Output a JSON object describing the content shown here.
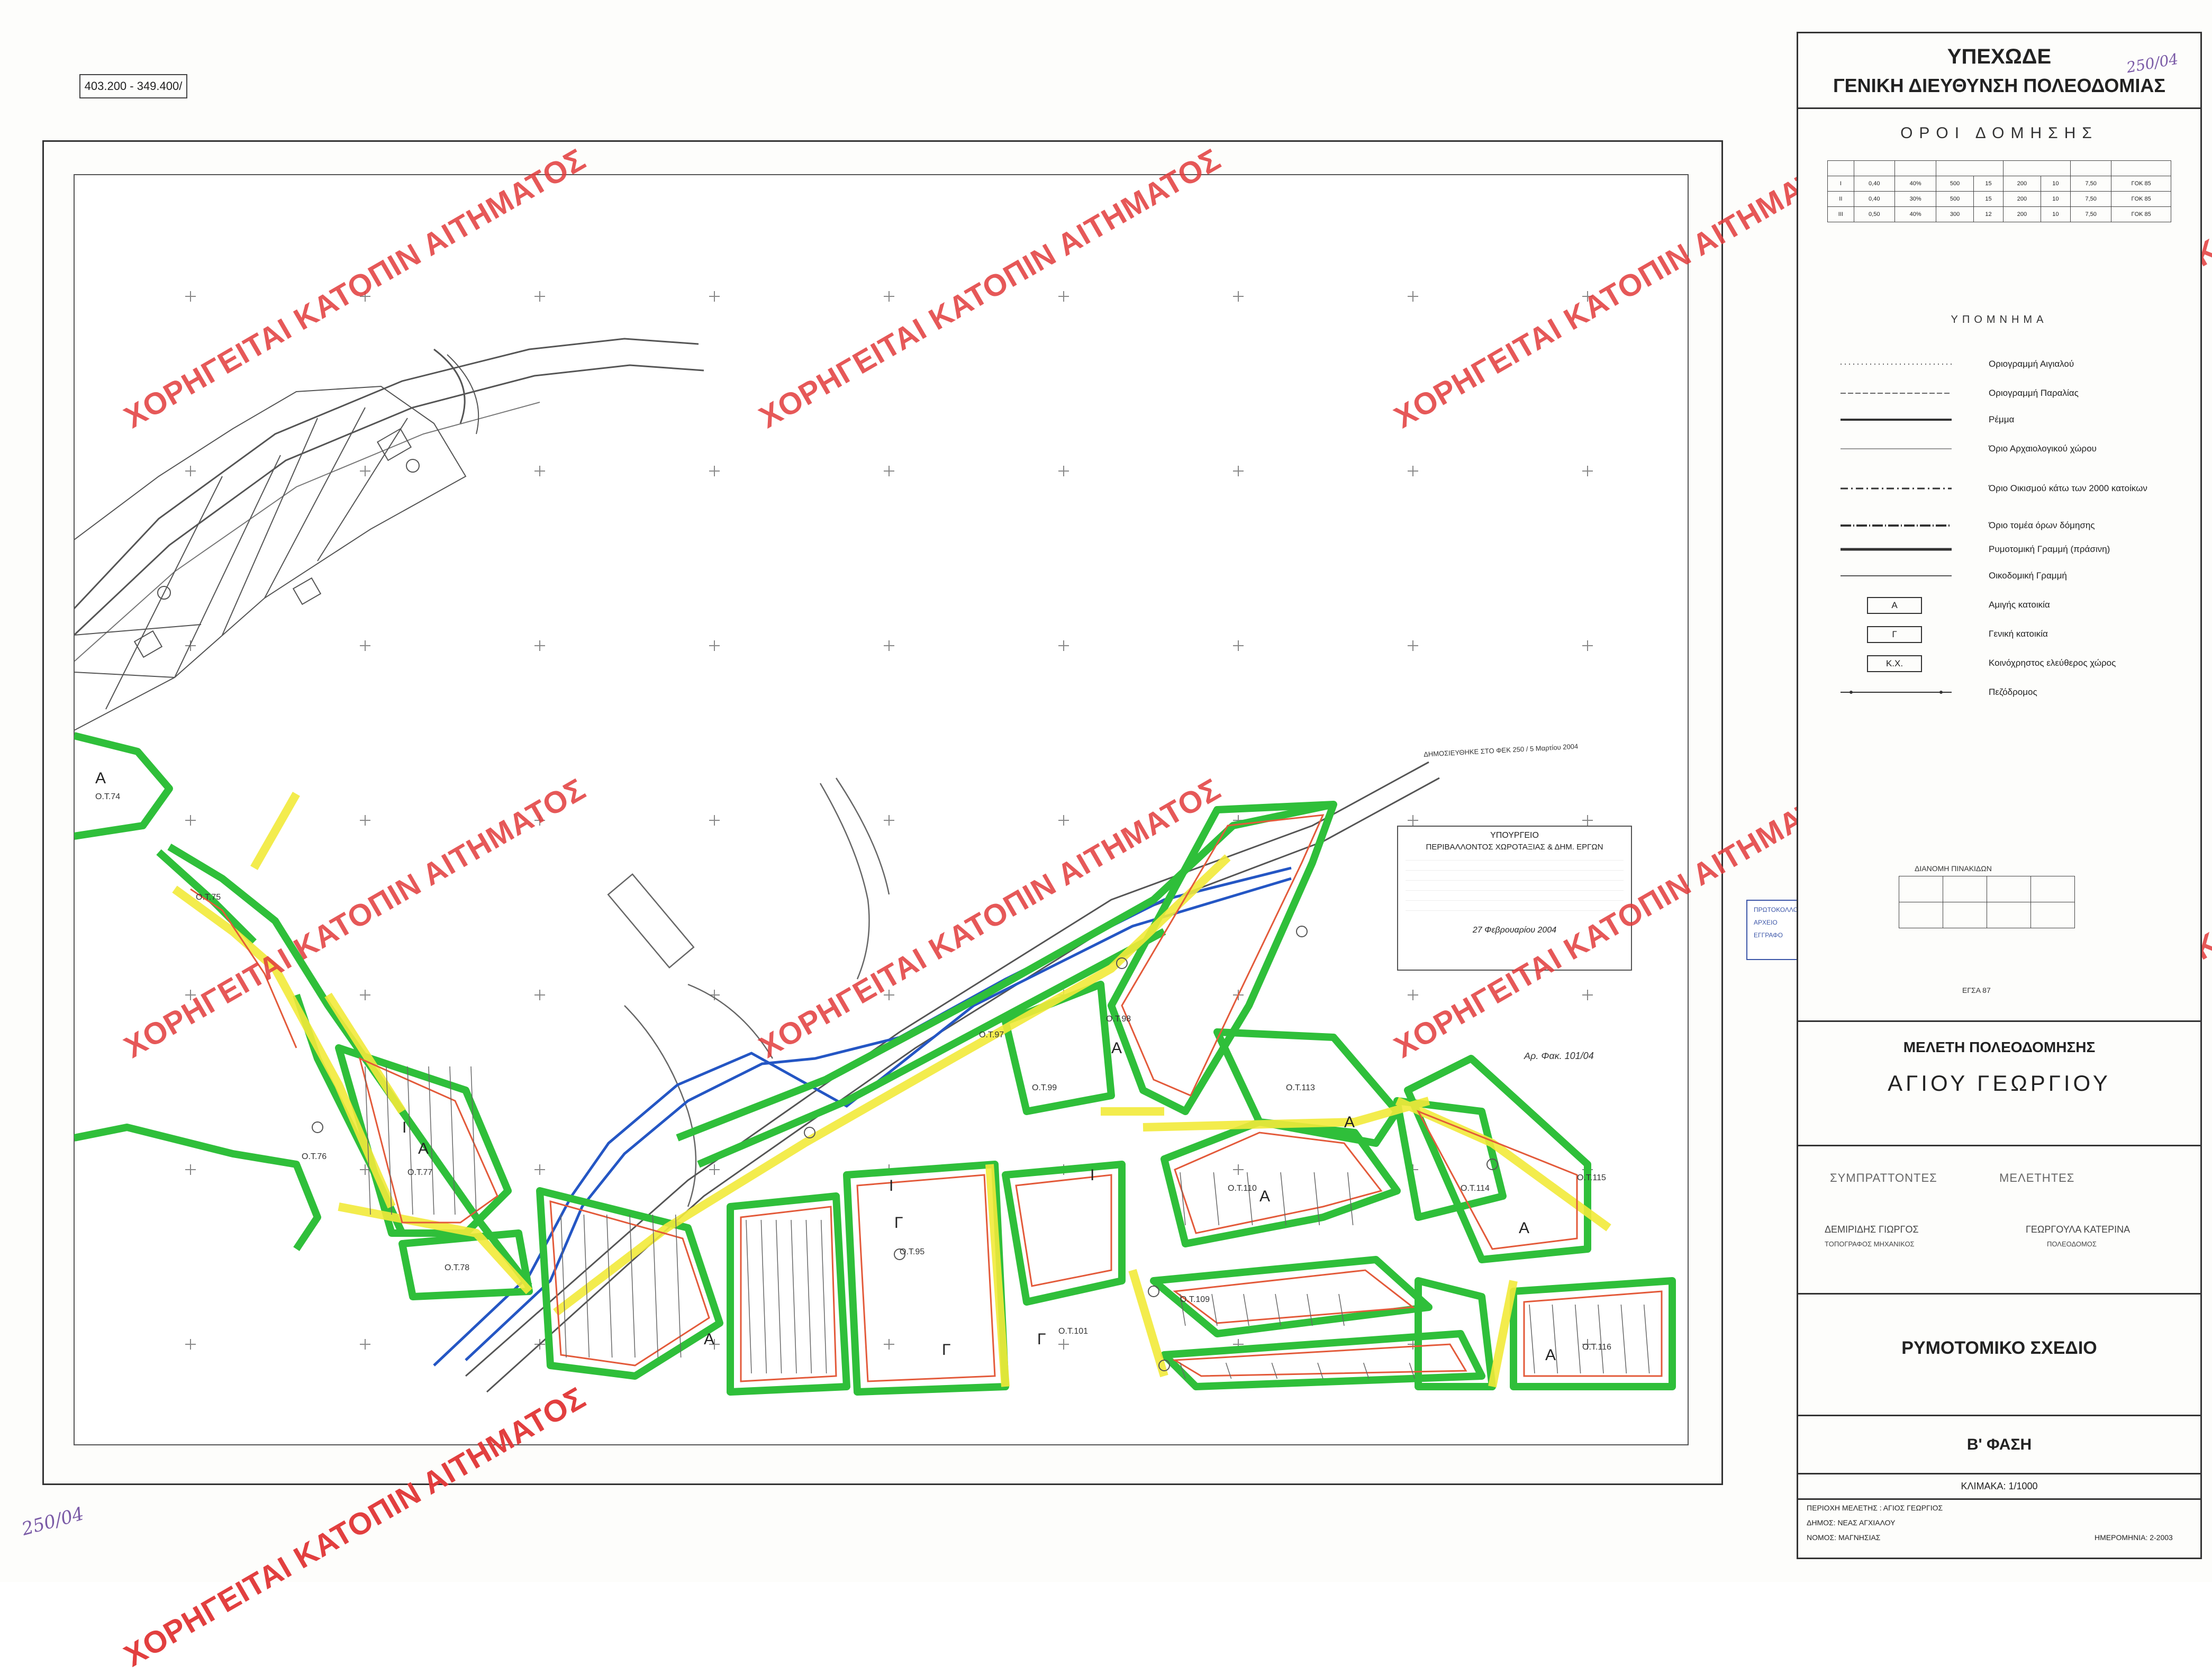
{
  "map": {
    "reference_code": "403.200 - 349.400/",
    "watermark_text": "ΧΟΡΗΓΕΙΤΑΙ ΚΑΤΟΠΙΝ ΑΙΤΗΜΑΤΟΣ",
    "handwritten_number": "250/04",
    "colors": {
      "watermark": "#e23b3b",
      "zone_green": "#2fbf3a",
      "zone_yellow": "#f2ea3a",
      "zone_red": "#e35a3a",
      "stream_blue": "#2456c4",
      "base_line": "#444444"
    },
    "block_labels": [
      "Ο.Τ.74",
      "Ο.Τ.75",
      "Ο.Τ.76",
      "Ο.Τ.77",
      "Ο.Τ.78",
      "Ο.Τ.95",
      "Ο.Τ.97",
      "Ο.Τ.98",
      "Ο.Τ.99",
      "Ο.Τ.101",
      "Ο.Τ.109",
      "Ο.Τ.110",
      "Ο.Τ.113",
      "Ο.Τ.114",
      "Ο.Τ.115",
      "Ο.Τ.116"
    ],
    "zone_letters": [
      "Α",
      "Γ",
      "Ι"
    ],
    "approval_stamp": {
      "title": "ΥΠΟΥΡΓΕΙΟ",
      "subtitle": "ΠΕΡΙΒΑΛΛΟΝΤΟΣ ΧΩΡΟΤΑΞΙΑΣ & ΔΗΜ. ΕΡΓΩΝ",
      "note": "Αρ. Φακ. 101/04",
      "date": "27 Φεβρουαρίου 2004"
    },
    "gazette_note": "ΔΗΜΟΣΙΕΥΘΗΚΕ ΣΤΟ ΦΕΚ 250 / 5 Μαρτίου 2004",
    "record_stamp": {
      "line1": "ΠΡΩΤΟΚΟΛΛΟ",
      "line2": "ΑΡΧΕΙΟ",
      "line3": "ΕΓΓΡΑΦΟ"
    }
  },
  "title_block": {
    "ministry": "ΥΠΕΧΩΔΕ",
    "directorate": "ΓΕΝΙΚΗ ΔΙΕΥΘΥΝΣΗ ΠΟΛΕΟΔΟΜΙΑΣ",
    "handwritten": "250/04",
    "terms_title": "ΟΡΟΙ ΔΟΜΗΣΗΣ",
    "terms_rows": [
      [
        "Ι",
        "0,40",
        "40%",
        "500",
        "15",
        "200",
        "10",
        "7,50",
        "ΓΟΚ 85"
      ],
      [
        "ΙΙ",
        "0,40",
        "30%",
        "500",
        "15",
        "200",
        "10",
        "7,50",
        "ΓΟΚ 85"
      ],
      [
        "ΙΙΙ",
        "0,50",
        "40%",
        "300",
        "12",
        "200",
        "10",
        "7,50",
        "ΓΟΚ 85"
      ]
    ],
    "legend_title": "ΥΠΟΜΝΗΜΑ",
    "legend": [
      "Οριογραμμή Αιγιαλού",
      "Οριογραμμή Παραλίας",
      "Ρέμμα",
      "Όριο Αρχαιολογικού χώρου",
      "Όριο Οικισμού κάτω των 2000 κατοίκων",
      "Όριο τομέα όρων δόμησης",
      "Ρυμοτομική Γραμμή (πράσινη)",
      "Οικοδομική Γραμμή",
      "Αμιγής κατοικία",
      "Γενική κατοικία",
      "Κοινόχρηστος ελεύθερος χώρος",
      "Πεζόδρομος"
    ],
    "legend_box_labels": [
      "Α",
      "Γ",
      "Κ.Χ."
    ],
    "sheet_index_title": "ΔΙΑΝΟΜΗ ΠΙΝΑΚΙΔΩΝ",
    "sheet_index_caption": "ΕΓΣΑ 87",
    "study_title": "ΜΕΛΕΤΗ ΠΟΛΕΟΔΟΜΗΣΗΣ",
    "place": "ΑΓΙΟΥ ΓΕΩΡΓΙΟΥ",
    "contractors_label": "ΣΥΜΠΡΑΤΤΟΝΤΕΣ",
    "designers_label": "ΜΕΛΕΤΗΤΕΣ",
    "person1_name": "ΔΕΜΙΡΙΔΗΣ ΓΙΩΡΓΟΣ",
    "person1_role": "ΤΟΠΟΓΡΑΦΟΣ ΜΗΧΑΝΙΚΟΣ",
    "person2_name": "ΓΕΩΡΓΟΥΛΑ ΚΑΤΕΡΙΝΑ",
    "person2_role": "ΠΟΛΕΟΔΟΜΟΣ",
    "plan_type": "ΡΥΜΟΤΟΜΙΚΟ ΣΧΕΔΙΟ",
    "phase": "Β' ΦΑΣΗ",
    "scale": "ΚΛΙΜΑΚΑ: 1/1000",
    "area": "ΠΕΡΙΟΧΗ ΜΕΛΕΤΗΣ : ΑΓΙΟΣ ΓΕΩΡΓΙΟΣ",
    "municipality": "ΔΗΜΟΣ: ΝΕΑΣ ΑΓΧΙΑΛΟΥ",
    "prefecture": "ΝΟΜΟΣ: ΜΑΓΝΗΣΙΑΣ",
    "date": "ΗΜΕΡΟΜΗΝΙΑ: 2-2003"
  }
}
